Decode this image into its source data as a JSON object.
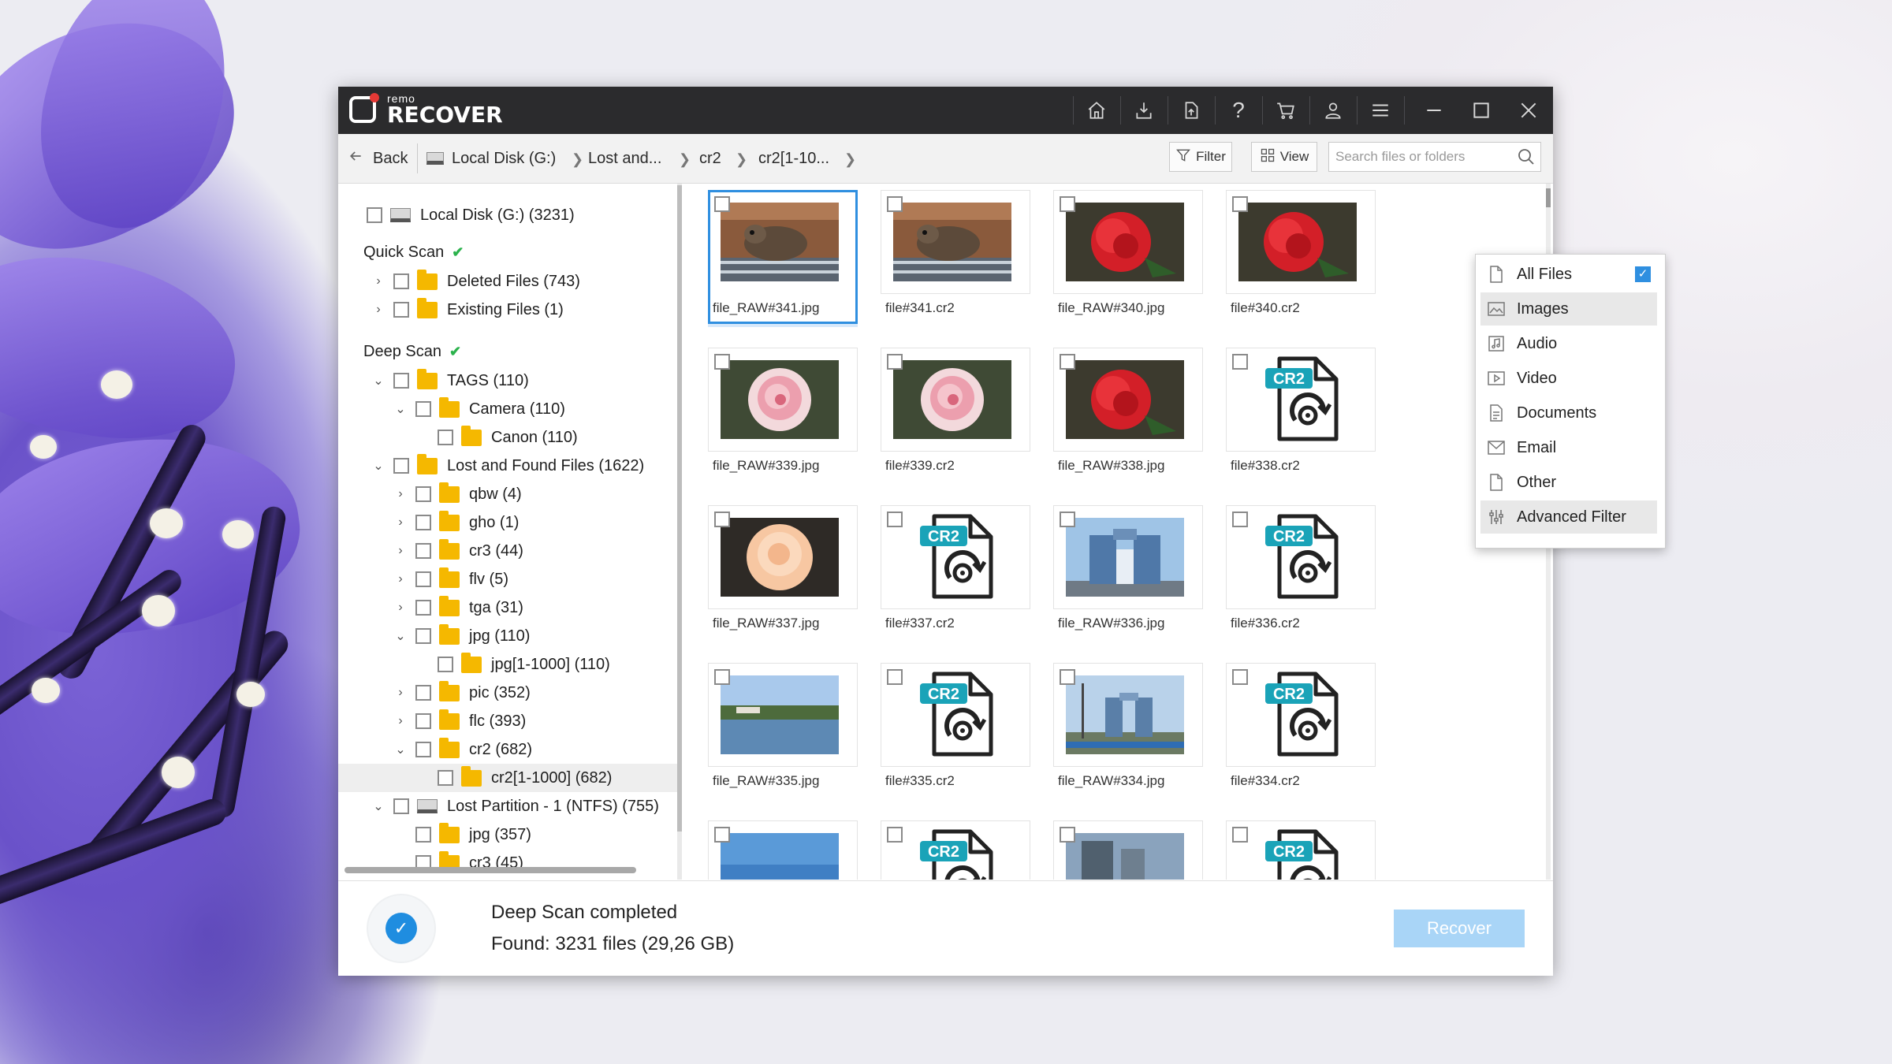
{
  "app": {
    "brand_small": "remo",
    "brand_big": "RECOVER"
  },
  "toolbar_icons": [
    "home-icon",
    "import-icon",
    "export-icon",
    "help-icon",
    "cart-icon",
    "user-icon",
    "menu-icon",
    "minimize-icon",
    "maximize-icon",
    "close-icon"
  ],
  "nav": {
    "back": "Back",
    "crumbs": [
      "Local Disk (G:)",
      "Lost and...",
      "cr2",
      "cr2[1-10..."
    ],
    "filter": "Filter",
    "view": "View",
    "search_placeholder": "Search files or folders"
  },
  "tree": {
    "root": "Local Disk (G:) (3231)",
    "quick_scan": "Quick Scan",
    "deep_scan": "Deep Scan",
    "quick_items": [
      "Deleted Files (743)",
      "Existing Files (1)"
    ],
    "deep_items": [
      "TAGS (110)",
      "Camera (110)",
      "Canon (110)",
      "Lost and Found Files (1622)",
      "qbw (4)",
      "gho (1)",
      "cr3 (44)",
      "flv (5)",
      "tga (31)",
      "jpg (110)",
      "jpg[1-1000] (110)",
      "pic (352)",
      "flc (393)",
      "cr2 (682)",
      "cr2[1-1000] (682)",
      "Lost Partition - 1 (NTFS) (755)",
      "jpg (357)",
      "cr3 (45)"
    ]
  },
  "files": [
    {
      "name": "file_RAW#341.jpg",
      "kind": "photo",
      "style": "rodent"
    },
    {
      "name": "file#341.cr2",
      "kind": "photo",
      "style": "rodent"
    },
    {
      "name": "file_RAW#340.jpg",
      "kind": "photo",
      "style": "redrose"
    },
    {
      "name": "file#340.cr2",
      "kind": "photo",
      "style": "redrose"
    },
    {
      "name": "file_RAW#339.jpg",
      "kind": "photo",
      "style": "pinkrose"
    },
    {
      "name": "file#339.cr2",
      "kind": "photo",
      "style": "pinkrose"
    },
    {
      "name": "file_RAW#338.jpg",
      "kind": "photo",
      "style": "redrose"
    },
    {
      "name": "file#338.cr2",
      "kind": "cr2"
    },
    {
      "name": "file_RAW#337.jpg",
      "kind": "photo",
      "style": "peachrose"
    },
    {
      "name": "file#337.cr2",
      "kind": "cr2"
    },
    {
      "name": "file_RAW#336.jpg",
      "kind": "photo",
      "style": "building"
    },
    {
      "name": "file#336.cr2",
      "kind": "cr2"
    },
    {
      "name": "file_RAW#335.jpg",
      "kind": "photo",
      "style": "lake"
    },
    {
      "name": "file#335.cr2",
      "kind": "cr2"
    },
    {
      "name": "file_RAW#334.jpg",
      "kind": "photo",
      "style": "building2"
    },
    {
      "name": "file#334.cr2",
      "kind": "cr2"
    },
    {
      "name": "",
      "kind": "photo",
      "style": "sky"
    },
    {
      "name": "",
      "kind": "cr2"
    },
    {
      "name": "",
      "kind": "photo",
      "style": "building3"
    },
    {
      "name": "",
      "kind": "cr2"
    }
  ],
  "cr2_label": "CR2",
  "filter_menu": [
    "All Files",
    "Images",
    "Audio",
    "Video",
    "Documents",
    "Email",
    "Other",
    "Advanced Filter"
  ],
  "status": {
    "line1": "Deep Scan completed",
    "line2": "Found: 3231 files (29,26 GB)",
    "recover": "Recover"
  },
  "colors": {
    "accent": "#2f8fe0",
    "titlebar": "#2b2b2d",
    "folder": "#f5b800",
    "recover_disabled": "#a9d5f7"
  }
}
